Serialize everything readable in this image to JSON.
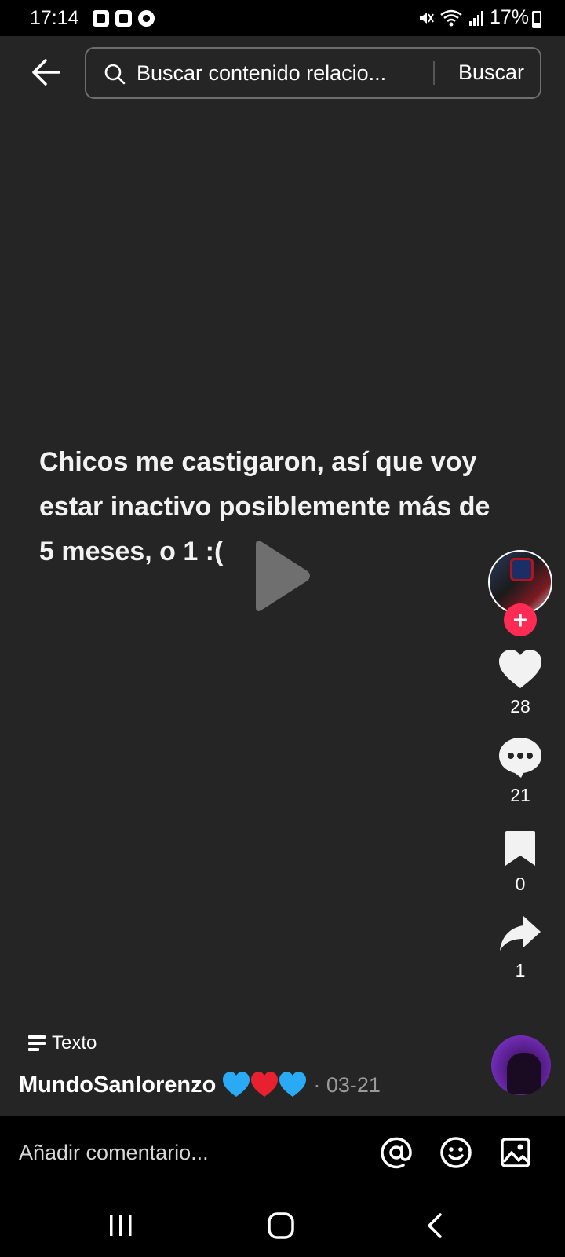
{
  "status_bar": {
    "time": "17:14",
    "battery": "17%",
    "left_icons": [
      "gallery-icon",
      "recorder-icon",
      "shazam-icon"
    ],
    "right_icons": [
      "mute-icon",
      "wifi-icon",
      "signal-icon",
      "battery-icon"
    ]
  },
  "topbar": {
    "search_placeholder": "Buscar contenido relacio...",
    "search_button": "Buscar"
  },
  "post": {
    "text": "Chicos me castigaron, así que voy estar inactivo posiblemente más de 5 meses, o 1 :(",
    "type_label": "Texto",
    "author": "MundoSanlorenzo",
    "date": "· 03-21"
  },
  "actions": {
    "likes": "28",
    "comments": "21",
    "saves": "0",
    "shares": "1"
  },
  "comment_bar": {
    "placeholder": "Añadir comentario..."
  },
  "colors": {
    "background": "#252525",
    "accent_red": "#fe2c55",
    "heart_blue": "#2aa9f5",
    "heart_red": "#e8202f"
  }
}
